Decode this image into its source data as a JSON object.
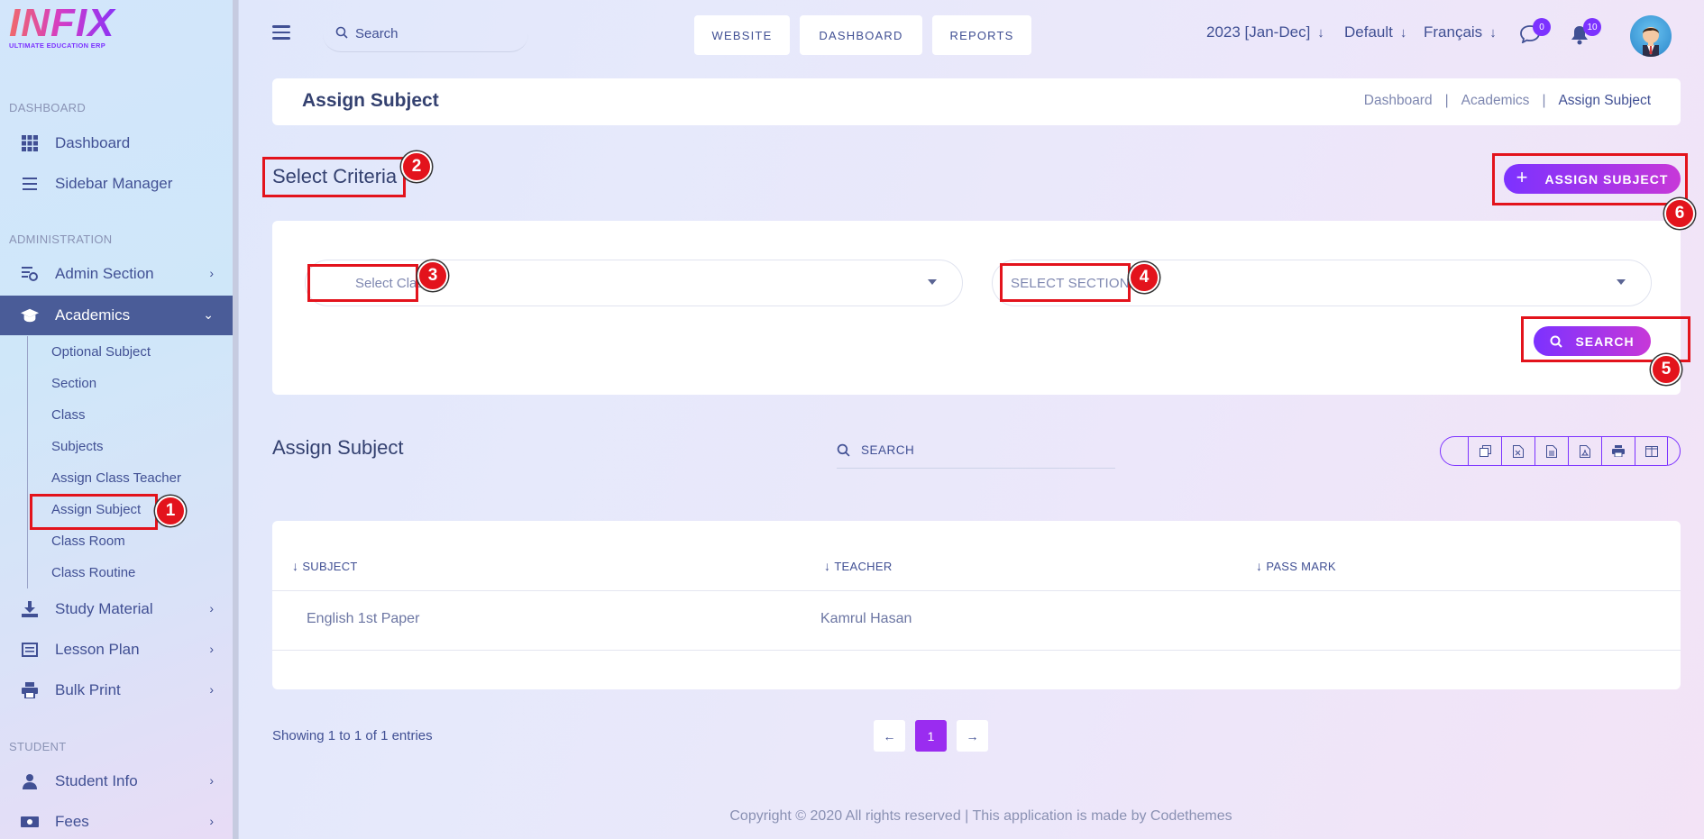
{
  "brand": {
    "logo_text": "INFIX",
    "logo_sub": "ULTIMATE EDUCATION ERP"
  },
  "sidebar": {
    "section_dashboard": "DASHBOARD",
    "section_administration": "ADMINISTRATION",
    "section_student": "STUDENT",
    "dashboard": "Dashboard",
    "sidebar_manager": "Sidebar Manager",
    "admin_section": "Admin Section",
    "academics": "Academics",
    "academics_sub": [
      "Optional Subject",
      "Section",
      "Class",
      "Subjects",
      "Assign Class Teacher",
      "Assign Subject",
      "Class Room",
      "Class Routine"
    ],
    "study_material": "Study Material",
    "lesson_plan": "Lesson Plan",
    "bulk_print": "Bulk Print",
    "student_info": "Student Info",
    "fees": "Fees"
  },
  "topbar": {
    "search_placeholder": "Search",
    "buttons": [
      "WEBSITE",
      "DASHBOARD",
      "REPORTS"
    ],
    "session": "2023 [Jan-Dec]",
    "theme": "Default",
    "language": "Français",
    "messages_count": "0",
    "notifications_count": "10"
  },
  "header": {
    "title": "Assign Subject",
    "crumbs": [
      "Dashboard",
      "Academics",
      "Assign Subject"
    ],
    "crumb_sep": "|"
  },
  "criteria": {
    "title": "Select Criteria",
    "assign_button": "ASSIGN SUBJECT",
    "class_placeholder": "Select Class*",
    "section_placeholder": "SELECT SECTION *",
    "search_button": "SEARCH"
  },
  "table": {
    "title": "Assign Subject",
    "search_placeholder": "SEARCH",
    "columns": [
      "SUBJECT",
      "TEACHER",
      "PASS MARK"
    ],
    "rows": [
      {
        "subject": "English 1st Paper",
        "teacher": "Kamrul Hasan",
        "pass_mark": ""
      }
    ],
    "info": "Showing 1 to 1 of 1 entries",
    "current_page": "1"
  },
  "footer": {
    "text": "Copyright © 2020 All rights reserved | This application is made by Codethemes"
  },
  "annotations": [
    "1",
    "2",
    "3",
    "4",
    "5",
    "6"
  ],
  "colors": {
    "accent": "#7c32ff",
    "accent_end": "#c738d8",
    "annotation": "#e3131c",
    "text": "#415094",
    "active_nav": "#4a5c98"
  }
}
